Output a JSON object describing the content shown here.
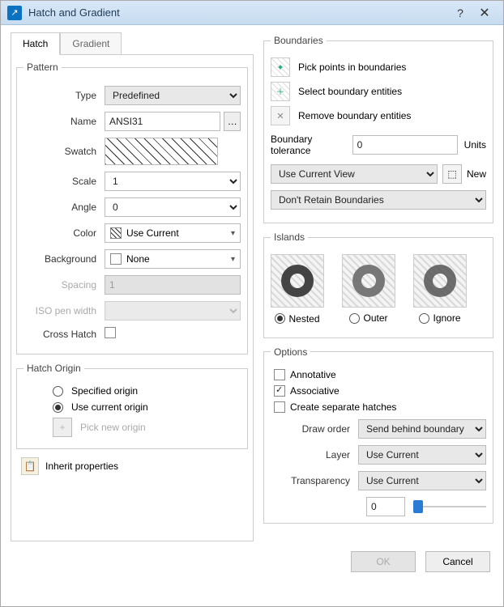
{
  "window": {
    "title": "Hatch and Gradient"
  },
  "tabs": {
    "hatch": "Hatch",
    "gradient": "Gradient"
  },
  "pattern": {
    "legend": "Pattern",
    "type_label": "Type",
    "type_value": "Predefined",
    "name_label": "Name",
    "name_value": "ANSI31",
    "swatch_label": "Swatch",
    "scale_label": "Scale",
    "scale_value": "1",
    "angle_label": "Angle",
    "angle_value": "0",
    "color_label": "Color",
    "color_value": "Use Current",
    "background_label": "Background",
    "background_value": "None",
    "spacing_label": "Spacing",
    "spacing_value": "1",
    "isopen_label": "ISO pen width",
    "cross_label": "Cross Hatch"
  },
  "origin": {
    "legend": "Hatch Origin",
    "specified": "Specified origin",
    "current": "Use current origin",
    "pick": "Pick new origin"
  },
  "inherit": {
    "label": "Inherit properties"
  },
  "boundaries": {
    "legend": "Boundaries",
    "pick": "Pick points in boundaries",
    "select": "Select boundary entities",
    "remove": "Remove boundary entities",
    "tol_label": "Boundary tolerance",
    "tol_value": "0",
    "units": "Units",
    "view": "Use Current View",
    "new": "New",
    "retain": "Don't Retain Boundaries"
  },
  "islands": {
    "legend": "Islands",
    "nested": "Nested",
    "outer": "Outer",
    "ignore": "Ignore"
  },
  "options": {
    "legend": "Options",
    "annotative": "Annotative",
    "associative": "Associative",
    "separate": "Create separate hatches",
    "draw_label": "Draw order",
    "draw_value": "Send behind boundary",
    "layer_label": "Layer",
    "layer_value": "Use Current",
    "trans_label": "Transparency",
    "trans_value": "Use Current",
    "trans_num": "0"
  },
  "footer": {
    "ok": "OK",
    "cancel": "Cancel"
  }
}
